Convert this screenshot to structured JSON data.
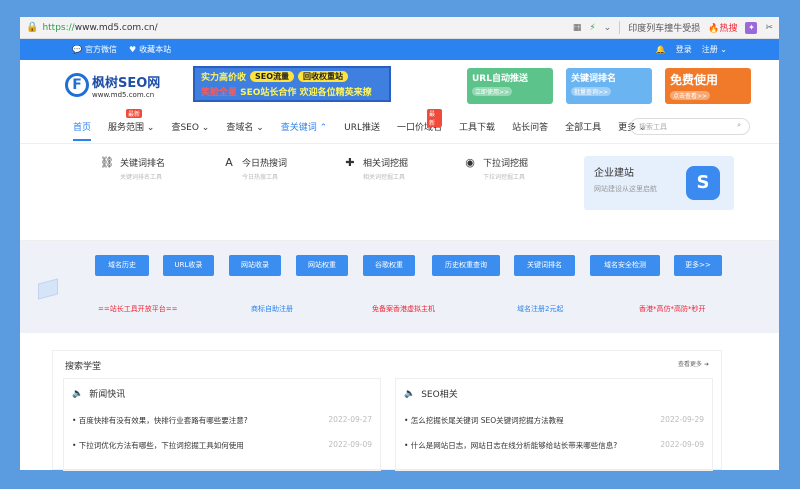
{
  "browser": {
    "url_prefix": "https://",
    "url_rest": "www.md5.com.cn/",
    "search_text": "印度列车撞牛受损",
    "hot_label": "热搜"
  },
  "topstrip": {
    "wechat": "官方微信",
    "bookmark": "收藏本站",
    "login": "登录",
    "register": "注册"
  },
  "header": {
    "logo_title": "枫树SEO网",
    "logo_sub": "www.md5.com.cn",
    "banner": {
      "lead": "实力高价收",
      "pill1": "SEO流量",
      "pill2": "回收权重站",
      "row2_red": "笑脸全星",
      "row2": "SEO站长合作 欢迎各位精英来撩"
    },
    "ads": [
      {
        "title": "URL自动推送",
        "sub": "立即使用>>"
      },
      {
        "title": "关键词排名",
        "sub": "批量查询>>"
      },
      {
        "title": "免费使用",
        "sub": "点击查看>>"
      }
    ]
  },
  "nav": {
    "items": [
      "首页",
      "服务范围",
      "查SEO",
      "查域名",
      "查关键词",
      "URL推送",
      "一口价域名",
      "工具下载",
      "站长问答",
      "全部工具",
      "更多"
    ],
    "hot_badge": "最新",
    "search_placeholder": "搜索工具"
  },
  "panel": {
    "items": [
      {
        "title": "关键词排名",
        "sub": "关键词排名工具"
      },
      {
        "title": "今日热搜词",
        "sub": "今日热搜工具"
      },
      {
        "title": "相关词挖掘",
        "sub": "相关词挖掘工具"
      },
      {
        "title": "下拉词挖掘",
        "sub": "下拉词挖掘工具"
      }
    ],
    "promo": {
      "title": "企业建站",
      "sub": "网站建设从这里启航"
    }
  },
  "tools": {
    "buttons": [
      "域名历史",
      "URL收录",
      "网站收录",
      "网站权重",
      "谷歌权重",
      "历史权重查询",
      "关键词排名",
      "域名安全检测",
      "更多>>"
    ],
    "links": [
      "==站长工具开放平台==",
      "商标自助注册",
      "免备案香港虚拟主机",
      "域名注册2元起",
      "香港*高仿*高防*秒开"
    ]
  },
  "learn": {
    "title": "搜索学堂",
    "more": "查看更多",
    "columns": [
      {
        "title": "新闻快讯",
        "rows": [
          {
            "text": "• 百度快排有没有效果，快排行业套路有哪些要注意?",
            "date": "2022-09-27"
          },
          {
            "text": "• 下拉词优化方法有哪些，下拉词挖掘工具如何使用",
            "date": "2022-09-09"
          }
        ]
      },
      {
        "title": "SEO相关",
        "rows": [
          {
            "text": "• 怎么挖掘长尾关键词 SEO关键词挖掘方法教程",
            "date": "2022-09-29"
          },
          {
            "text": "• 什么是网站日志，网站日志在线分析能够给站长带来哪些信息?",
            "date": "2022-09-09"
          }
        ]
      }
    ]
  }
}
